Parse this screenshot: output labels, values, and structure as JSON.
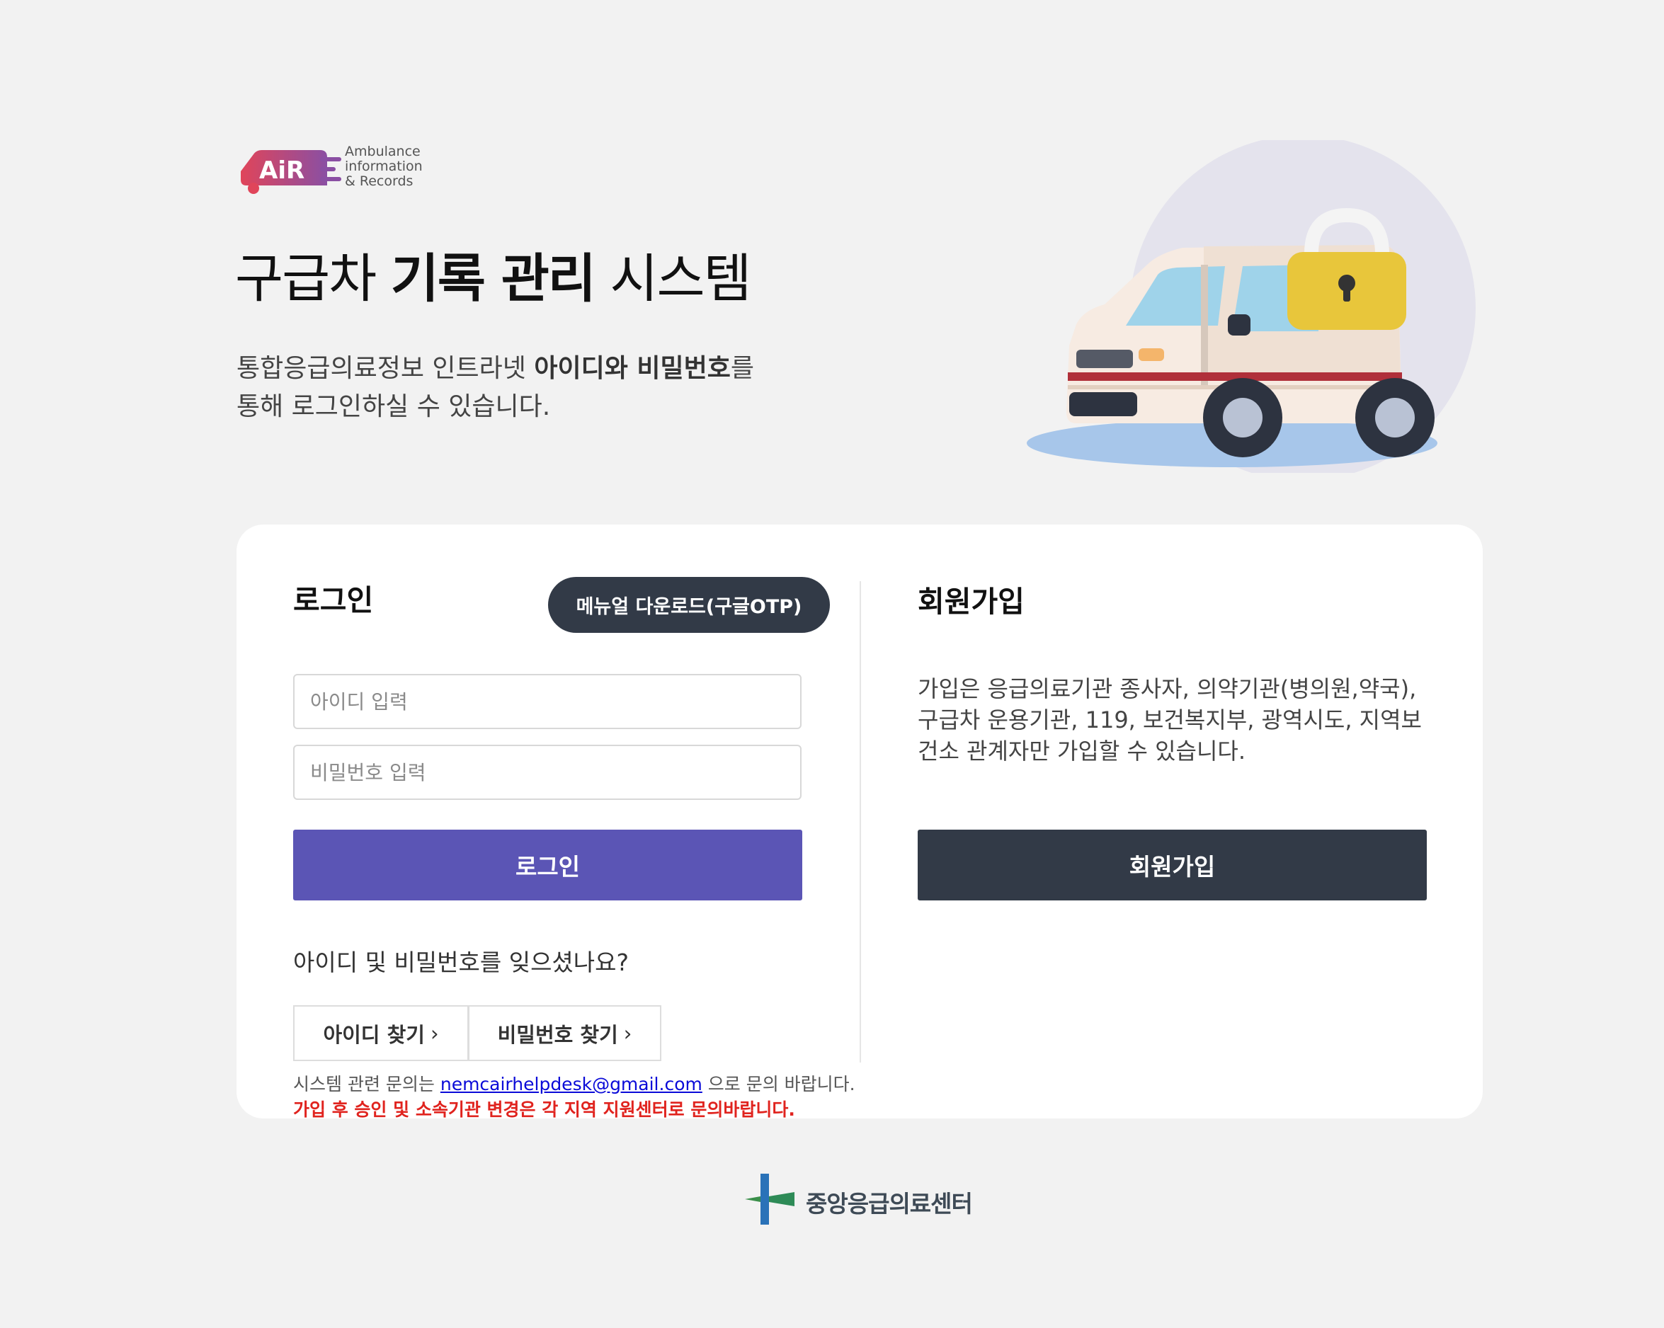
{
  "header": {
    "logo": {
      "mark_text": "AiR",
      "subtitle_lines": [
        "Ambulance",
        "information",
        "& Records"
      ],
      "brand_colors": [
        "#c54a6e",
        "#8a4fa3"
      ]
    },
    "title_plain": "구급차 ",
    "title_bold": "기록 관리",
    "title_tail": " 시스템",
    "intro_line1_prefix": "통합응급의료정보 인트라넷 ",
    "intro_line1_bold": "아이디와 비밀번호",
    "intro_line1_suffix": "를",
    "intro_line2": "통해 로그인하실 수 있습니다.",
    "hero_icon": "ambulance-lock-illustration"
  },
  "login": {
    "title": "로그인",
    "manual_button": "메뉴얼 다운로드(구글OTP)",
    "id_placeholder": "아이디 입력",
    "pw_placeholder": "비밀번호 입력",
    "login_button": "로그인",
    "forgot_text": "아이디 및 비밀번호를 잊으셨나요?",
    "find_id_button": "아이디 찾기",
    "find_pw_button": "비밀번호 찾기",
    "chevron_icon": "chevron-right-icon",
    "contact_prefix": "시스템 관련 문의는 ",
    "contact_email": "nemcairhelpdesk@gmail.com",
    "contact_suffix": " 으로 문의 바랍니다.",
    "notice": "가입 후 승인 및 소속기관 변경은 각 지역 지원센터로 문의바랍니다."
  },
  "signup": {
    "title": "회원가입",
    "description": "가입은 응급의료기관 종사자, 의약기관(병의원,약국), 구급차 운용기관, 119, 보건복지부, 광역시도, 지역보건소 관계자만 가입할 수 있습니다.",
    "button": "회원가입"
  },
  "footer": {
    "org_name": "중앙응급의료센터",
    "logo_icon": "cross-emblem-icon"
  },
  "colors": {
    "background": "#f2f2f2",
    "card": "#ffffff",
    "login_button": "#5b55b5",
    "dark_button": "#323a47",
    "notice_red": "#e0231e",
    "link_blue": "#0a0ad8"
  }
}
